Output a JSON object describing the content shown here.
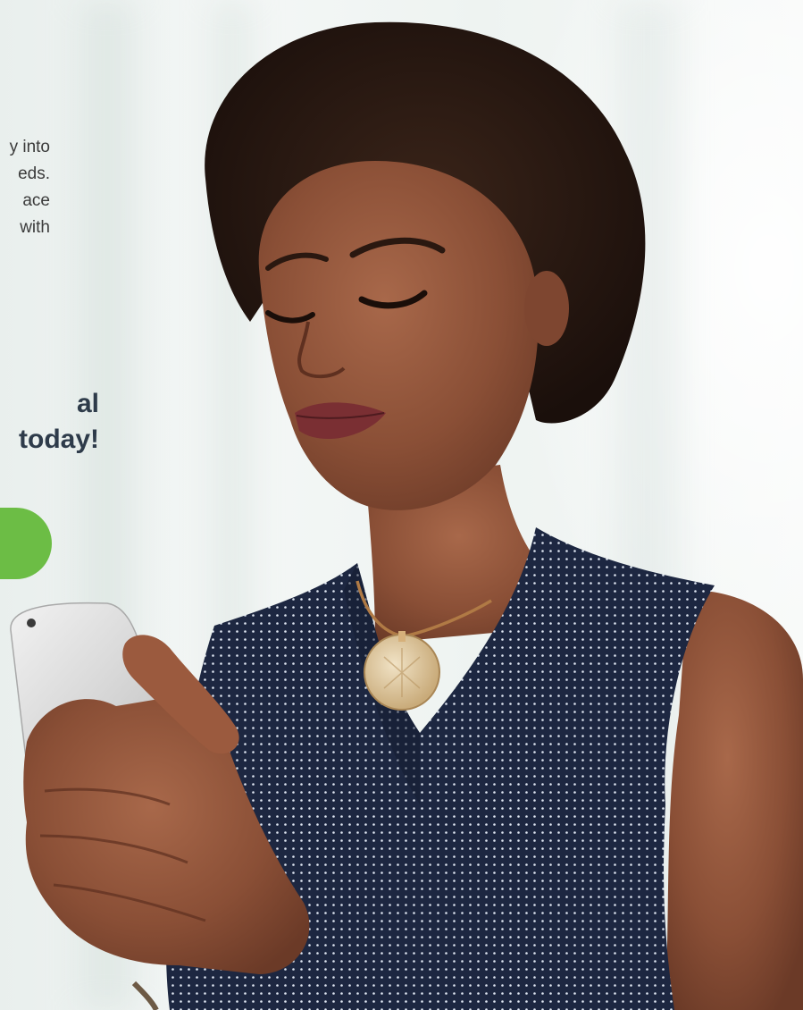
{
  "intro": {
    "lines": [
      "y into",
      "eds.",
      "ace",
      "with"
    ]
  },
  "headline": {
    "lines": [
      "al",
      "today!"
    ]
  },
  "cta": {
    "label": ""
  },
  "colors": {
    "accent_green": "#6cbd45",
    "headline": "#2e3b4a",
    "body_text": "#3b3b3b"
  },
  "photo": {
    "subject": "woman-using-smartphone"
  }
}
